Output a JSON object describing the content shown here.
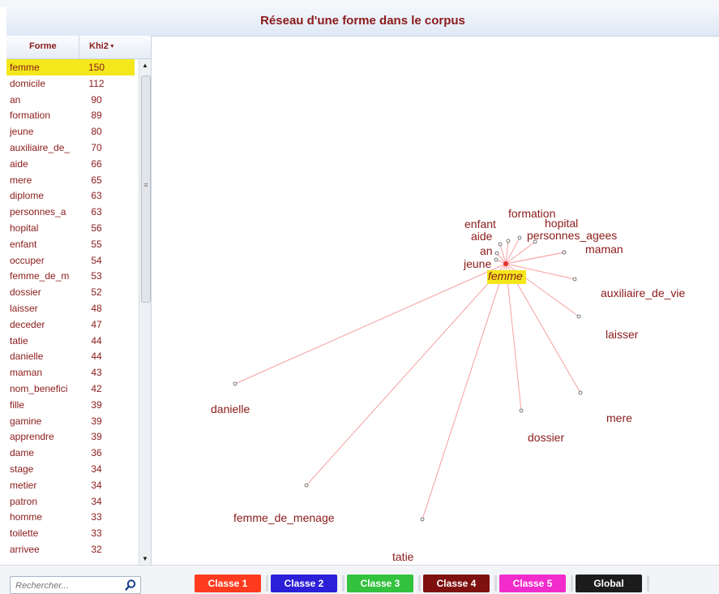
{
  "window": {
    "title": "Réseau d'une forme dans le corpus"
  },
  "table": {
    "col_forme": "Forme",
    "col_khi2": "Khi2",
    "rows": [
      {
        "forme": "femme",
        "khi2": "150"
      },
      {
        "forme": "domicile",
        "khi2": "112"
      },
      {
        "forme": "an",
        "khi2": "90"
      },
      {
        "forme": "formation",
        "khi2": "89"
      },
      {
        "forme": "jeune",
        "khi2": "80"
      },
      {
        "forme": "auxiliaire_de_",
        "khi2": "70"
      },
      {
        "forme": "aide",
        "khi2": "66"
      },
      {
        "forme": "mere",
        "khi2": "65"
      },
      {
        "forme": "diplome",
        "khi2": "63"
      },
      {
        "forme": "personnes_a",
        "khi2": "63"
      },
      {
        "forme": "hopital",
        "khi2": "56"
      },
      {
        "forme": "enfant",
        "khi2": "55"
      },
      {
        "forme": "occuper",
        "khi2": "54"
      },
      {
        "forme": "femme_de_m",
        "khi2": "53"
      },
      {
        "forme": "dossier",
        "khi2": "52"
      },
      {
        "forme": "laisser",
        "khi2": "48"
      },
      {
        "forme": "deceder",
        "khi2": "47"
      },
      {
        "forme": "tatie",
        "khi2": "44"
      },
      {
        "forme": "danielle",
        "khi2": "44"
      },
      {
        "forme": "maman",
        "khi2": "43"
      },
      {
        "forme": "nom_benefici",
        "khi2": "42"
      },
      {
        "forme": "fille",
        "khi2": "39"
      },
      {
        "forme": "gamine",
        "khi2": "39"
      },
      {
        "forme": "apprendre",
        "khi2": "39"
      },
      {
        "forme": "dame",
        "khi2": "36"
      },
      {
        "forme": "stage",
        "khi2": "34"
      },
      {
        "forme": "metier",
        "khi2": "34"
      },
      {
        "forme": "patron",
        "khi2": "34"
      },
      {
        "forme": "homme",
        "khi2": "33"
      },
      {
        "forme": "toilette",
        "khi2": "33"
      },
      {
        "forme": "arrivee",
        "khi2": "32"
      }
    ]
  },
  "network": {
    "center": "femme",
    "nodes": [
      "formation",
      "hopital",
      "enfant",
      "aide",
      "personnes_agees",
      "maman",
      "an",
      "jeune",
      "auxiliaire_de_vie",
      "laisser",
      "danielle",
      "mere",
      "dossier",
      "femme_de_menage",
      "tatie"
    ]
  },
  "search": {
    "placeholder": "Rechercher..."
  },
  "classes": {
    "buttons": [
      {
        "label": "Classe 1",
        "color": "#ff3b1f"
      },
      {
        "label": "Classe 2",
        "color": "#2b1fd8"
      },
      {
        "label": "Classe 3",
        "color": "#33c23e"
      },
      {
        "label": "Classe 4",
        "color": "#7e1010"
      },
      {
        "label": "Classe 5",
        "color": "#f22ccc"
      },
      {
        "label": "Global",
        "color": "#1c1c1c"
      }
    ]
  },
  "colors": {
    "accent": "#8b1a1a",
    "selection": "#f4e71b",
    "edge": "#f5a0a0"
  }
}
